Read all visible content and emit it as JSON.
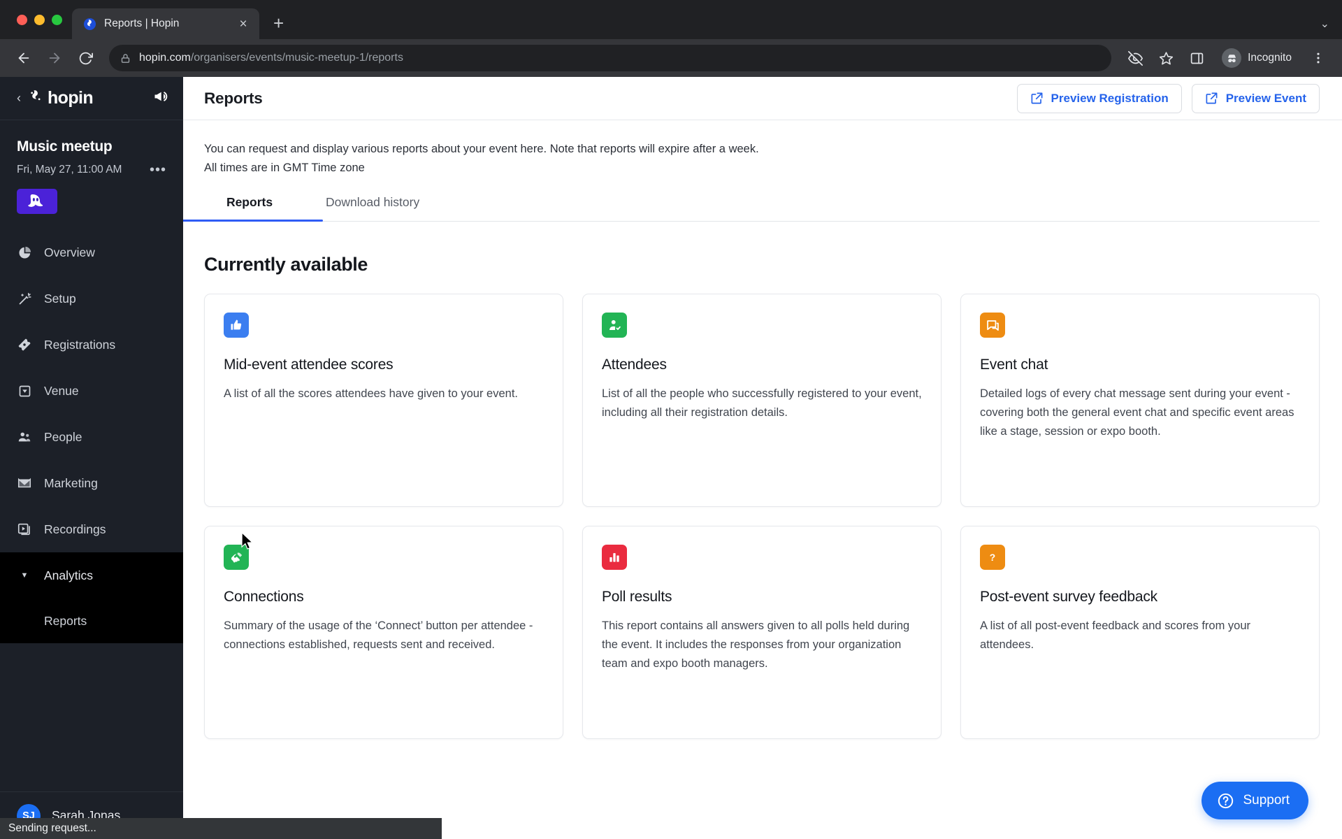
{
  "browser": {
    "tab": {
      "title": "Reports | Hopin",
      "favicon_icon": "hopin-favicon",
      "close_icon": "close-icon"
    },
    "new_tab_icon": "plus-icon",
    "tabstrip_menu_icon": "chevron-down-icon",
    "back_icon": "back-arrow-icon",
    "forward_icon": "forward-arrow-icon",
    "reload_icon": "reload-icon",
    "lock_icon": "lock-icon",
    "url_host": "hopin.com",
    "url_path": "/organisers/events/music-meetup-1/reports",
    "omnibox_icons": [
      "eye-slash-icon",
      "star-icon",
      "side-panel-icon"
    ],
    "profile": {
      "label": "Incognito",
      "icon": "incognito-icon"
    },
    "menu_icon": "three-dot-menu-icon"
  },
  "sidebar": {
    "back_icon": "chevron-left-icon",
    "brand": "hopin",
    "megaphone_icon": "megaphone-icon",
    "event": {
      "name": "Music meetup",
      "date": "Fri, May 27, 11:00 AM",
      "more_icon": "ellipsis-icon",
      "thumbnail_icon": "event-thumbnail-ghost"
    },
    "items": [
      {
        "label": "Overview",
        "icon": "pie-chart-icon"
      },
      {
        "label": "Setup",
        "icon": "magic-wand-icon"
      },
      {
        "label": "Registrations",
        "icon": "ticket-icon"
      },
      {
        "label": "Venue",
        "icon": "venue-pin-icon"
      },
      {
        "label": "People",
        "icon": "people-icon"
      },
      {
        "label": "Marketing",
        "icon": "envelope-icon"
      },
      {
        "label": "Recordings",
        "icon": "recordings-icon"
      }
    ],
    "analytics": {
      "label": "Analytics",
      "caret_icon": "caret-down-icon",
      "children": [
        {
          "label": "Reports"
        }
      ]
    },
    "user": {
      "initials": "SJ",
      "name": "Sarah Jonas"
    }
  },
  "header": {
    "title": "Reports",
    "actions": [
      {
        "label": "Preview Registration",
        "icon": "external-link-icon"
      },
      {
        "label": "Preview Event",
        "icon": "external-link-icon"
      }
    ]
  },
  "intro": {
    "line1": "You can request and display various reports about your event here. Note that reports will expire after a week.",
    "line2": "All times are in GMT Time zone"
  },
  "tabs": [
    {
      "label": "Reports",
      "active": true
    },
    {
      "label": "Download history",
      "active": false
    }
  ],
  "section": {
    "title": "Currently available"
  },
  "cards": [
    {
      "title": "Mid-event attendee scores",
      "desc": "A list of all the scores attendees have given to your event.",
      "icon": "thumbs-up-icon",
      "color": "#3b7ef0"
    },
    {
      "title": "Attendees",
      "desc": "List of all the people who successfully registered to your event, including all their registration details.",
      "icon": "person-check-icon",
      "color": "#22b455"
    },
    {
      "title": "Event chat",
      "desc": "Detailed logs of every chat message sent during your event - covering both the general event chat and specific event areas like a stage, session or expo booth.",
      "icon": "chat-bubble-icon",
      "color": "#ee8c12"
    },
    {
      "title": "Connections",
      "desc": "Summary of the usage of the ‘Connect’ button per attendee - connections established, requests sent and received.",
      "icon": "handshake-icon",
      "color": "#22b455"
    },
    {
      "title": "Poll results",
      "desc": "This report contains all answers given to all polls held during the event. It includes the responses from your organization team and expo booth managers.",
      "icon": "bar-chart-icon",
      "color": "#ea2b3f"
    },
    {
      "title": "Post-event survey feedback",
      "desc": "A list of all post-event feedback and scores from your attendees.",
      "icon": "question-mark-icon",
      "color": "#ee8c12"
    }
  ],
  "support": {
    "label": "Support",
    "icon": "help-circle-icon"
  },
  "statusbar": {
    "text": "Sending request..."
  },
  "colors": {
    "accent_blue": "#2563eb",
    "tab_underline": "#2f5cf5",
    "sidebar_bg": "#1c2028",
    "sidebar_active_bg": "#000000",
    "support_blue": "#1b6ef3"
  }
}
